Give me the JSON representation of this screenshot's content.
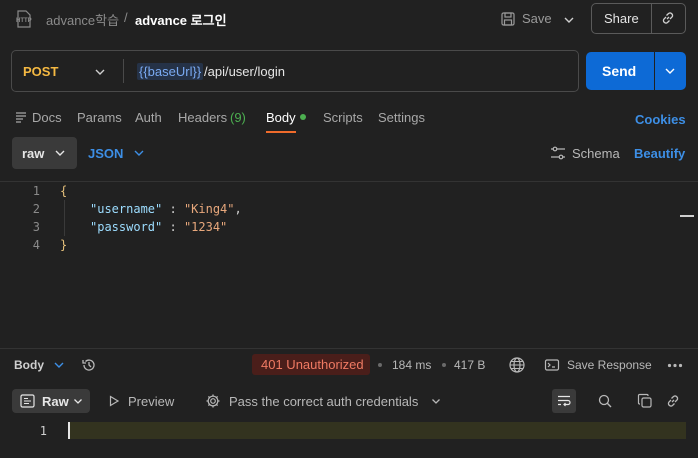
{
  "breadcrumb": {
    "parent": "advance학습",
    "separator": "/",
    "current": "advance 로그인"
  },
  "header": {
    "save_label": "Save",
    "share_label": "Share"
  },
  "request": {
    "method": "POST",
    "url_variable": "{{baseUrl}}",
    "url_path": "/api/user/login",
    "send_label": "Send"
  },
  "tabs": {
    "docs": "Docs",
    "params": "Params",
    "auth": "Auth",
    "headers": "Headers",
    "headers_count": "(9)",
    "body": "Body",
    "scripts": "Scripts",
    "settings": "Settings",
    "cookies": "Cookies"
  },
  "body_mode": {
    "mode": "raw",
    "format": "JSON",
    "schema_label": "Schema",
    "beautify_label": "Beautify"
  },
  "editor": {
    "line_numbers": [
      "1",
      "2",
      "3",
      "4"
    ],
    "line1": "{",
    "line2_key": "\"username\"",
    "line2_sep": " : ",
    "line2_val": "\"King4\"",
    "line2_end": ",",
    "line3_key": "\"password\"",
    "line3_sep": " : ",
    "line3_val": "\"1234\"",
    "line4": "}"
  },
  "response": {
    "body_label": "Body",
    "status": "401 Unauthorized",
    "time": "184 ms",
    "size": "417 B",
    "save_response_label": "Save Response",
    "view_mode": "Raw",
    "preview_label": "Preview",
    "auth_message": "Pass the correct auth credentials",
    "line_number": "1"
  },
  "colors": {
    "accent_blue": "#0d6ad6",
    "method_post": "#f5b942",
    "status_error": "#f07a63",
    "active_tab_underline": "#f06b2b",
    "success_green": "#4caf50"
  },
  "icons": [
    "http-icon",
    "save-icon",
    "chevron-down-icon",
    "link-icon",
    "docs-icon",
    "schema-icon",
    "history-icon",
    "globe-icon",
    "save-response-icon",
    "more-icon",
    "raw-view-icon",
    "preview-icon",
    "gear-icon",
    "wrap-icon",
    "search-icon",
    "copy-icon"
  ]
}
